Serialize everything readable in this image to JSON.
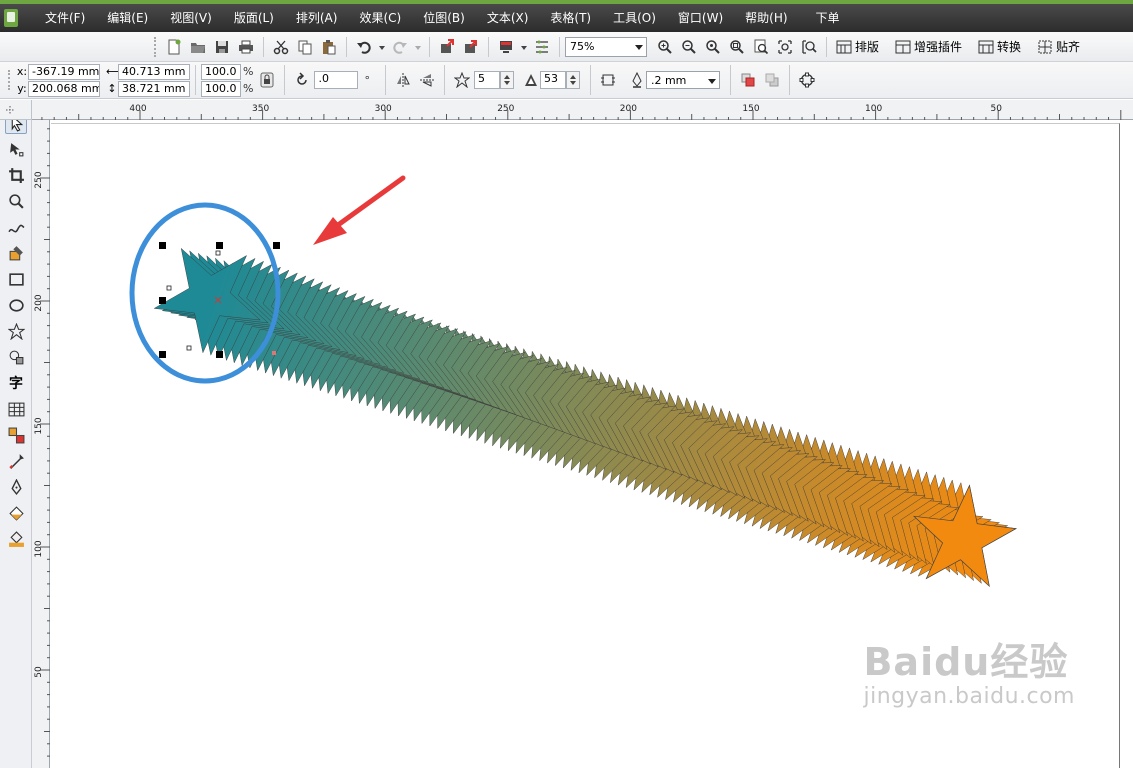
{
  "menu": [
    "文件(F)",
    "编辑(E)",
    "视图(V)",
    "版面(L)",
    "排列(A)",
    "效果(C)",
    "位图(B)",
    "文本(X)",
    "表格(T)",
    "工具(O)",
    "窗口(W)",
    "帮助(H)",
    "下单"
  ],
  "toolbar": {
    "zoom": "75%",
    "plugin_buttons": [
      "排版",
      "增强插件",
      "转换",
      "贴齐"
    ]
  },
  "property_bar": {
    "x_label": "x:",
    "x": "-367.19 mm",
    "y_label": "y:",
    "y": "200.068 mm",
    "width": "40.713 mm",
    "height": "38.721 mm",
    "scale_x": "100.0",
    "scale_y": "100.0",
    "percent": "%",
    "rotation": ".0",
    "degree": "°",
    "star_points": "5",
    "star_sharpness": "53",
    "outline_width": ".2 mm"
  },
  "ruler": {
    "h_labels": [
      "400",
      "350",
      "300",
      "250",
      "200",
      "150",
      "100",
      "50"
    ],
    "v_labels": [
      "250",
      "200",
      "150",
      "100",
      "50"
    ]
  },
  "tools": [
    "pick",
    "shape",
    "crop",
    "zoom",
    "freehand",
    "smart-fill",
    "rectangle",
    "ellipse",
    "polygon",
    "basic-shapes",
    "text",
    "table",
    "blend",
    "eyedropper",
    "outline",
    "fill",
    "interactive-fill"
  ],
  "artwork": {
    "gradient_start": "#1e8a96",
    "gradient_end": "#f28a10",
    "highlight_circle": "#3c8fd8",
    "arrow_color": "#e83a3a"
  },
  "watermark": {
    "brand": "Baidu经验",
    "url": "jingyan.baidu.com"
  }
}
